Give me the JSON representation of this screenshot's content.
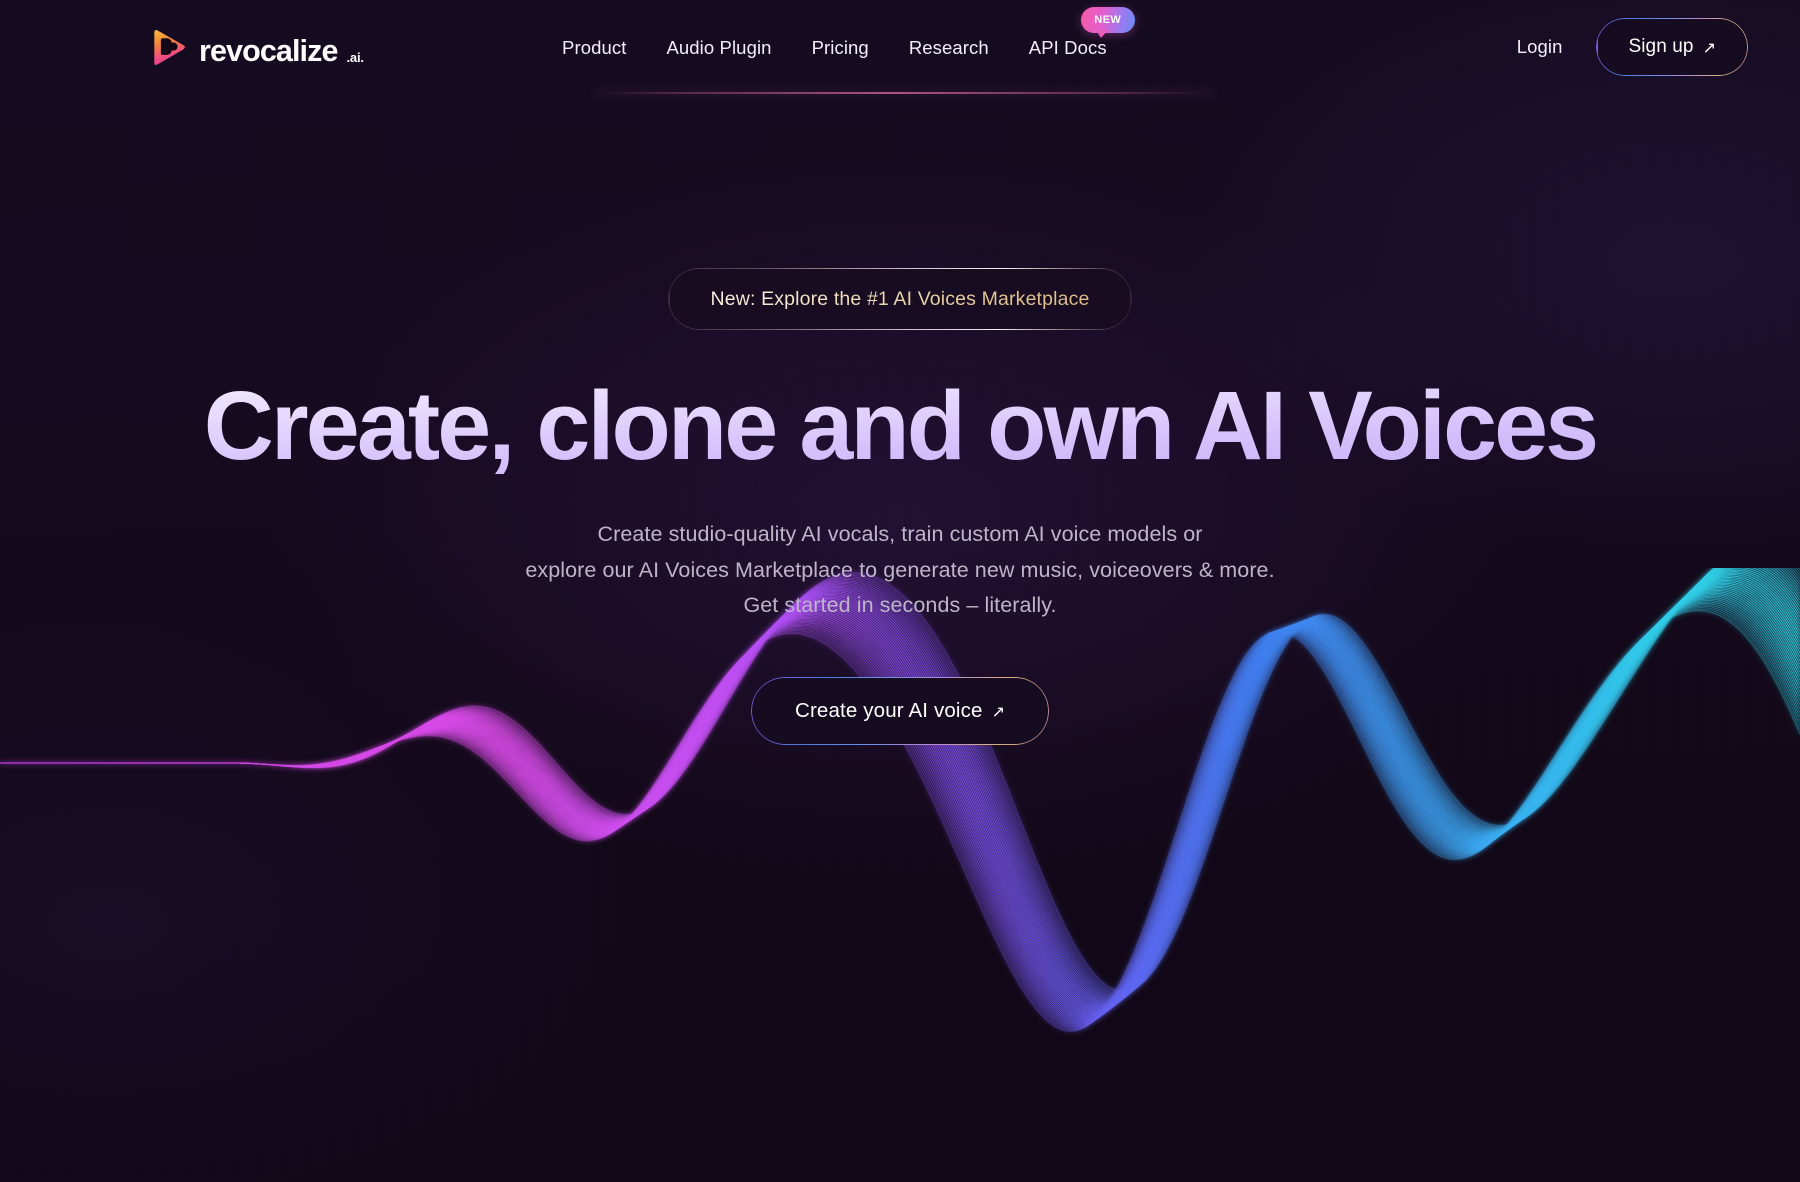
{
  "brand": {
    "logo_icon": "play-triangle-icon",
    "name": "revocalize",
    "suffix": ".ai."
  },
  "header": {
    "nav": [
      {
        "label": "Product",
        "name": "nav-product"
      },
      {
        "label": "Audio Plugin",
        "name": "nav-audio-plugin"
      },
      {
        "label": "Pricing",
        "name": "nav-pricing"
      },
      {
        "label": "Research",
        "name": "nav-research"
      },
      {
        "label": "API Docs",
        "name": "nav-api-docs",
        "badge": "NEW"
      }
    ],
    "login_label": "Login",
    "signup_label": "Sign up",
    "signup_arrow": "↗"
  },
  "hero": {
    "pill_label": "New: Explore the #1 AI Voices Marketplace",
    "headline": "Create, clone and own AI Voices",
    "subtitle_line1": "Create studio-quality AI vocals, train custom AI voice models or",
    "subtitle_line2": "explore our AI Voices Marketplace to generate new music, voiceovers & more.",
    "subtitle_line3": "Get started in seconds – literally.",
    "cta_label": "Create your AI voice",
    "cta_arrow": "↗"
  },
  "colors": {
    "background": "#130a1c",
    "headline_text": "#ddccfb",
    "subtitle_text": "#bdb5c8",
    "pill_text": "#e9d4ac",
    "badge_gradient_start": "#f65ba6",
    "badge_gradient_end": "#6d8df5",
    "logo_gradient_start": "#f5a33c",
    "logo_gradient_end": "#ee3d8e",
    "wave_magenta": "#d94ae8",
    "wave_purple": "#8b4ef0",
    "wave_blue": "#3fa9f5",
    "wave_cyan": "#2fd8e8",
    "nav_divider": "#e268b0"
  },
  "waveform": {
    "name": "audio-waveform-visual",
    "line_count": 46,
    "description": "phase-shifted sine ribbon, flat on the far left, rising into magenta peak, purple trough, blue peaks at right"
  }
}
